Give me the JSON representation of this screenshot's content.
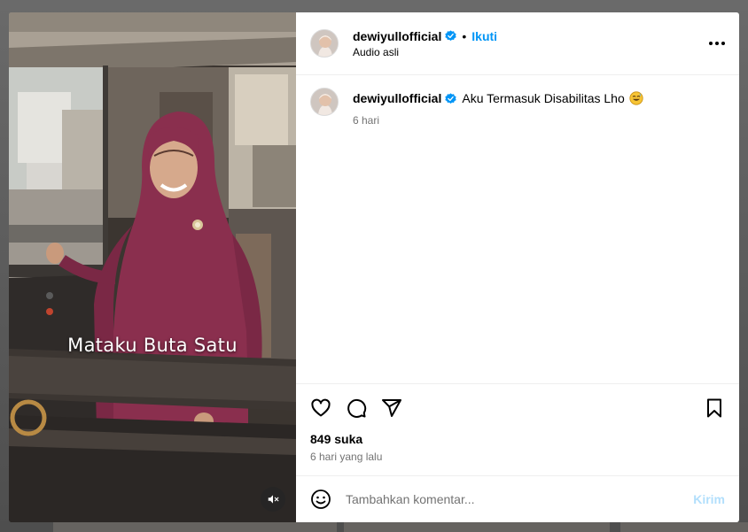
{
  "post": {
    "username": "dewiyullofficial",
    "follow_label": "Ikuti",
    "separator": "•",
    "audio_label": "Audio asli"
  },
  "video": {
    "caption_overlay": "Mataku Buta Satu",
    "muted": true
  },
  "caption": {
    "username": "dewiyullofficial",
    "text": "Aku Termasuk Disabilitas Lho",
    "emoji": "grinning-face-with-sweat-emoji",
    "age": "6 hari"
  },
  "engagement": {
    "likes": "849 suka",
    "posted": "6 hari yang lalu"
  },
  "composer": {
    "placeholder": "Tambahkan komentar...",
    "submit_label": "Kirim"
  },
  "colors": {
    "verified_blue": "#0095f6",
    "follow_blue": "#0095f6",
    "submit_disabled": "#b2dffc",
    "secondary_text": "#737373"
  },
  "icons": [
    "verified-badge-icon",
    "more-options-icon",
    "like-heart-icon",
    "comment-bubble-icon",
    "share-paper-plane-icon",
    "save-bookmark-icon",
    "emoji-picker-icon",
    "muted-speaker-icon"
  ]
}
